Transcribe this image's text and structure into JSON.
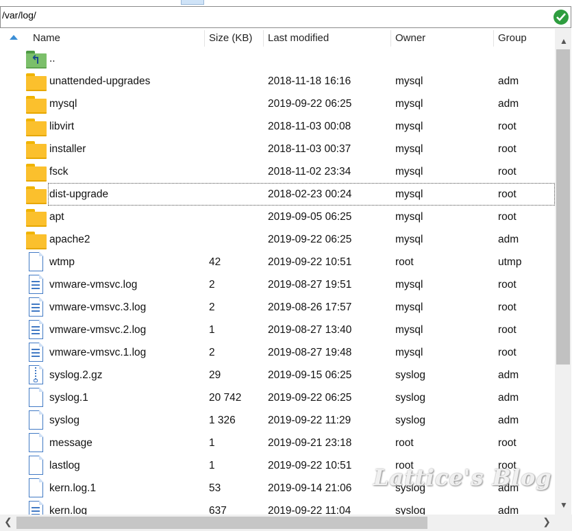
{
  "path_bar": {
    "value": "/var/log/",
    "status_icon": "check-circle-icon"
  },
  "columns": {
    "name": "Name",
    "size": "Size (KB)",
    "modified": "Last modified",
    "owner": "Owner",
    "group": "Group"
  },
  "rows": [
    {
      "name": "..",
      "size": "",
      "modified": "",
      "owner": "",
      "group": "",
      "icon": "parent-folder-icon"
    },
    {
      "name": "unattended-upgrades",
      "size": "",
      "modified": "2018-11-18 16:16",
      "owner": "mysql",
      "group": "adm",
      "icon": "folder-icon"
    },
    {
      "name": "mysql",
      "size": "",
      "modified": "2019-09-22 06:25",
      "owner": "mysql",
      "group": "adm",
      "icon": "folder-icon"
    },
    {
      "name": "libvirt",
      "size": "",
      "modified": "2018-11-03 00:08",
      "owner": "mysql",
      "group": "root",
      "icon": "folder-icon"
    },
    {
      "name": "installer",
      "size": "",
      "modified": "2018-11-03 00:37",
      "owner": "mysql",
      "group": "root",
      "icon": "folder-icon"
    },
    {
      "name": "fsck",
      "size": "",
      "modified": "2018-11-02 23:34",
      "owner": "mysql",
      "group": "root",
      "icon": "folder-icon"
    },
    {
      "name": "dist-upgrade",
      "size": "",
      "modified": "2018-02-23 00:24",
      "owner": "mysql",
      "group": "root",
      "icon": "folder-icon"
    },
    {
      "name": "apt",
      "size": "",
      "modified": "2019-09-05 06:25",
      "owner": "mysql",
      "group": "root",
      "icon": "folder-icon"
    },
    {
      "name": "apache2",
      "size": "",
      "modified": "2019-09-22 06:25",
      "owner": "mysql",
      "group": "adm",
      "icon": "folder-icon"
    },
    {
      "name": "wtmp",
      "size": "42",
      "modified": "2019-09-22 10:51",
      "owner": "root",
      "group": "utmp",
      "icon": "file-icon"
    },
    {
      "name": "vmware-vmsvc.log",
      "size": "2",
      "modified": "2019-08-27 19:51",
      "owner": "mysql",
      "group": "root",
      "icon": "text-file-icon"
    },
    {
      "name": "vmware-vmsvc.3.log",
      "size": "2",
      "modified": "2019-08-26 17:57",
      "owner": "mysql",
      "group": "root",
      "icon": "text-file-icon"
    },
    {
      "name": "vmware-vmsvc.2.log",
      "size": "1",
      "modified": "2019-08-27 13:40",
      "owner": "mysql",
      "group": "root",
      "icon": "text-file-icon"
    },
    {
      "name": "vmware-vmsvc.1.log",
      "size": "2",
      "modified": "2019-08-27 19:48",
      "owner": "mysql",
      "group": "root",
      "icon": "text-file-icon"
    },
    {
      "name": "syslog.2.gz",
      "size": "29",
      "modified": "2019-09-15 06:25",
      "owner": "syslog",
      "group": "adm",
      "icon": "zip-file-icon"
    },
    {
      "name": "syslog.1",
      "size": "20 742",
      "modified": "2019-09-22 06:25",
      "owner": "syslog",
      "group": "adm",
      "icon": "file-icon"
    },
    {
      "name": "syslog",
      "size": "1 326",
      "modified": "2019-09-22 11:29",
      "owner": "syslog",
      "group": "adm",
      "icon": "file-icon"
    },
    {
      "name": "message",
      "size": "1",
      "modified": "2019-09-21 23:18",
      "owner": "root",
      "group": "root",
      "icon": "file-icon"
    },
    {
      "name": "lastlog",
      "size": "1",
      "modified": "2019-09-22 10:51",
      "owner": "root",
      "group": "root",
      "icon": "file-icon"
    },
    {
      "name": "kern.log.1",
      "size": "53",
      "modified": "2019-09-14 21:06",
      "owner": "syslog",
      "group": "adm",
      "icon": "file-icon"
    },
    {
      "name": "kern.log",
      "size": "637",
      "modified": "2019-09-22 11:04",
      "owner": "syslog",
      "group": "adm",
      "icon": "text-file-icon"
    }
  ],
  "focused_row": "dist-upgrade",
  "watermark": "Lattice's Blog",
  "colors": {
    "accent": "#3c8fd6",
    "folder": "#fbc02d",
    "check": "#2e9d3f"
  }
}
